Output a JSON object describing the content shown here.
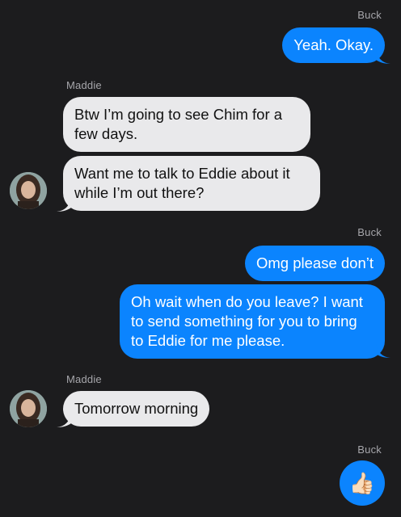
{
  "messages": [
    {
      "sender": "Buck",
      "text": "Yeah. Okay."
    },
    {
      "sender": "Maddie",
      "text": "Btw I’m going to see Chim for a few days."
    },
    {
      "sender": "Maddie",
      "text": "Want me to talk to Eddie about it while I’m out there?"
    },
    {
      "sender": "Buck",
      "text": "Omg please don’t"
    },
    {
      "sender": "Buck",
      "text": "Oh wait when do you leave? I want to send something for you to bring to Eddie for me please."
    },
    {
      "sender": "Maddie",
      "text": "Tomorrow morning"
    },
    {
      "sender": "Buck",
      "text": "👍🏻"
    }
  ],
  "labels": {
    "buck_1": "Buck",
    "maddie_1": "Maddie",
    "buck_2": "Buck",
    "maddie_2": "Maddie",
    "buck_3": "Buck"
  },
  "colors": {
    "background": "#1c1c1e",
    "outgoing_bubble": "#0b84fe",
    "incoming_bubble": "#e9e9eb"
  }
}
